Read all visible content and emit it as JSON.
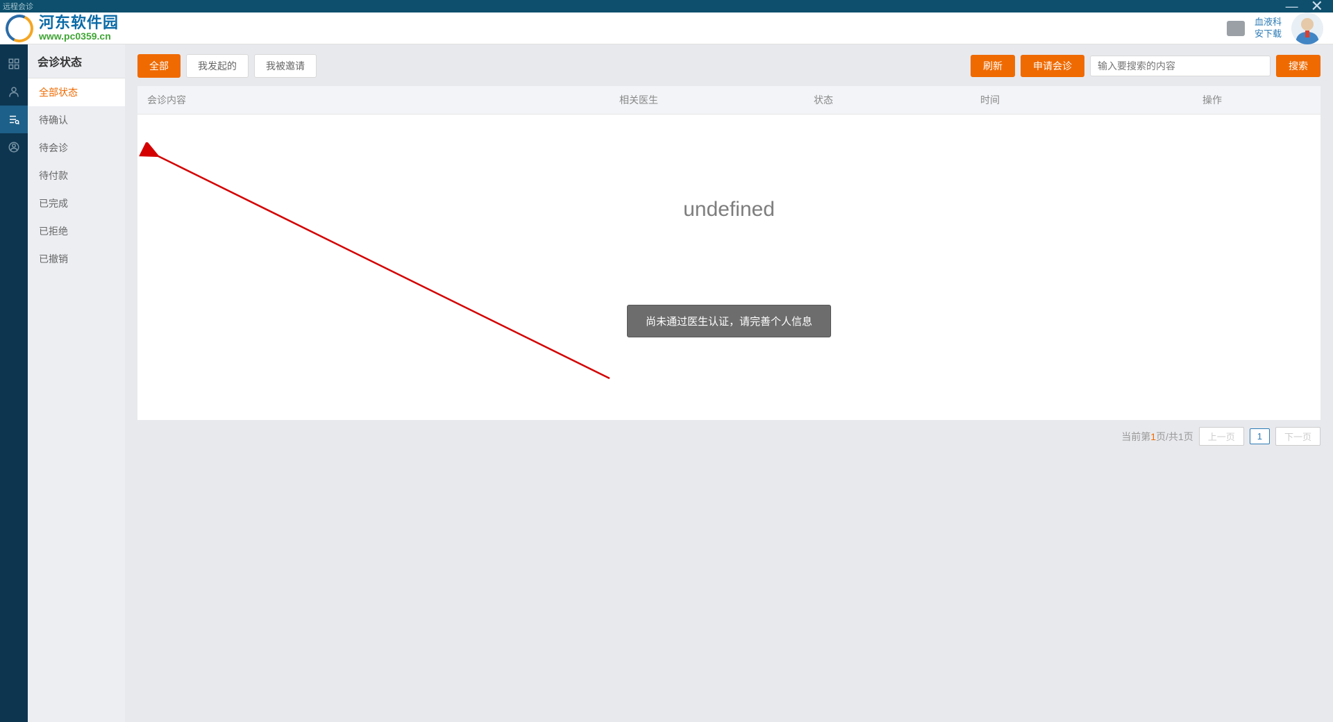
{
  "window": {
    "title": "远程会诊"
  },
  "logo": {
    "cn": "河东软件园",
    "en": "www.pc0359.cn"
  },
  "user": {
    "dept": "血液科",
    "name": "安下载"
  },
  "sidebar": {
    "title": "会诊状态",
    "items": [
      {
        "label": "全部状态"
      },
      {
        "label": "待确认"
      },
      {
        "label": "待会诊"
      },
      {
        "label": "待付款"
      },
      {
        "label": "已完成"
      },
      {
        "label": "已拒绝"
      },
      {
        "label": "已撤销"
      }
    ]
  },
  "tabs": {
    "all": "全部",
    "mine": "我发起的",
    "invited": "我被邀请"
  },
  "actions": {
    "refresh": "刷新",
    "apply": "申请会诊",
    "search": "搜索",
    "search_placeholder": "输入要搜索的内容"
  },
  "columns": {
    "content": "会诊内容",
    "doctor": "相关医生",
    "status": "状态",
    "time": "时间",
    "action": "操作"
  },
  "empty": {
    "undefined": "undefined",
    "alert": "尚未通过医生认证，请完善个人信息"
  },
  "pagination": {
    "info_prefix": "当前第",
    "info_cur": "1",
    "info_mid": "页/共",
    "info_total": "1",
    "info_suffix": "页",
    "prev": "上一页",
    "num": "1",
    "next": "下一页"
  }
}
